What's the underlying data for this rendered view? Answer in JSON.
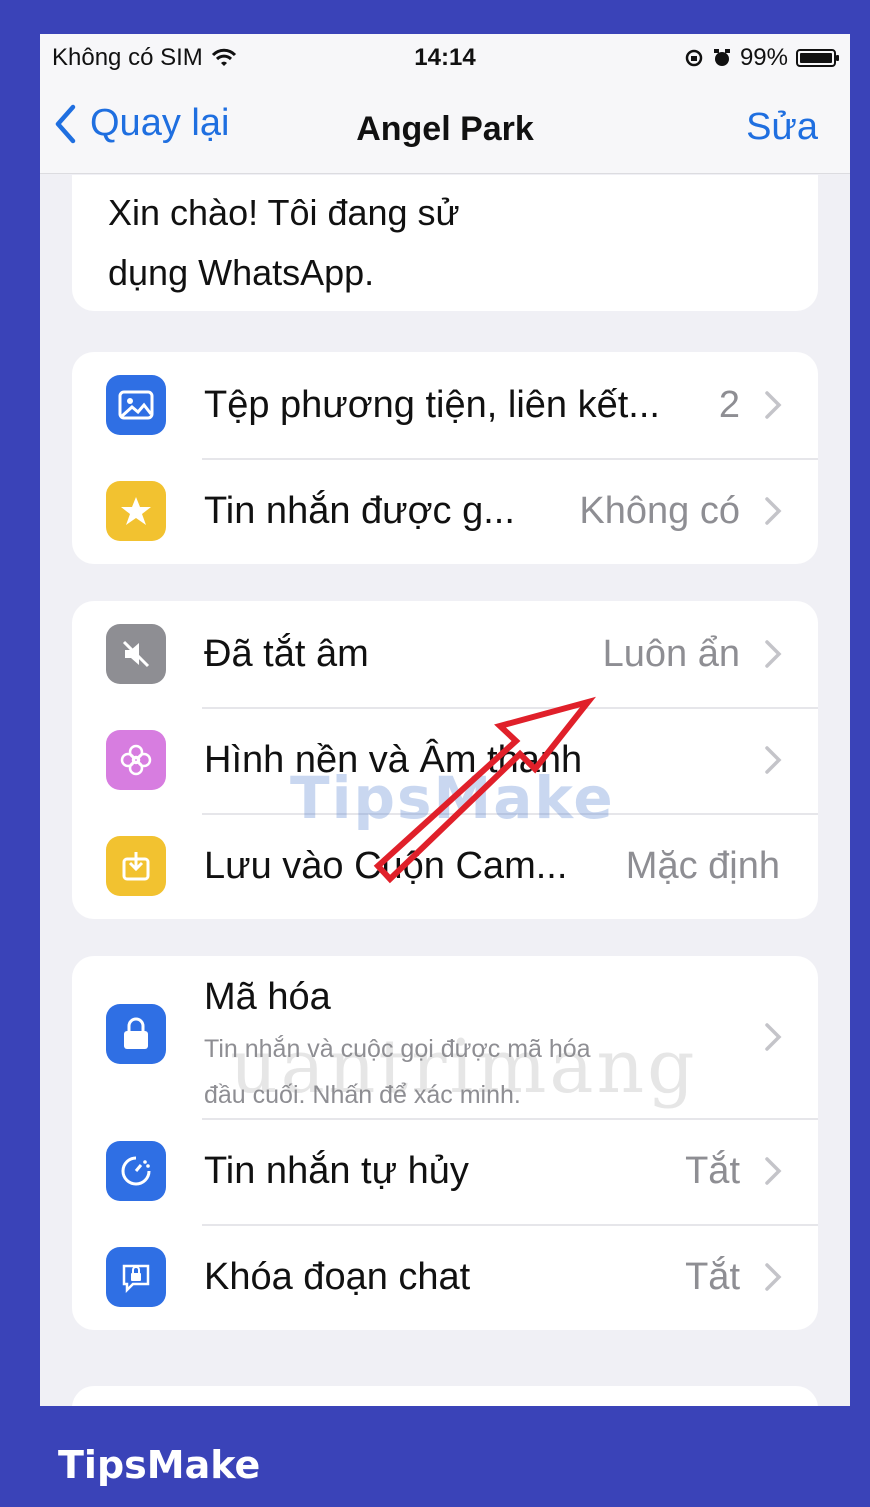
{
  "status": {
    "carrier": "Không có SIM",
    "time": "14:14",
    "battery": "99%",
    "battery_level": 0.99
  },
  "nav": {
    "back_label": "Quay lại",
    "title": "Angel Park",
    "edit_label": "Sửa"
  },
  "about": {
    "line1": "Xin chào! Tôi đang sử",
    "line2": "dụng WhatsApp."
  },
  "group1": [
    {
      "label": "Tệp phương tiện, liên kết...",
      "value": "2",
      "icon": "photo-icon",
      "color": "#2f6fe4"
    },
    {
      "label": "Tin nhắn được g...",
      "value": "Không có",
      "icon": "star-icon",
      "color": "#f2c230"
    }
  ],
  "group2": [
    {
      "label": "Đã tắt âm",
      "value": "Luôn ẩn",
      "icon": "mute-icon",
      "color": "#8e8e93"
    },
    {
      "label": "Hình nền và Âm thanh",
      "value": "",
      "icon": "flower-icon",
      "color": "#d77de0"
    },
    {
      "label": "Lưu vào Cuộn Cam...",
      "value": "Mặc định",
      "icon": "save-icon",
      "color": "#f2c230"
    }
  ],
  "group3": [
    {
      "label": "Mã hóa",
      "sub1": "Tin nhắn và cuộc gọi được mã hóa",
      "sub2": "đầu cuối. Nhấn để xác minh.",
      "value": "",
      "icon": "lock-icon",
      "color": "#2f6fe4"
    },
    {
      "label": "Tin nhắn tự hủy",
      "value": "Tắt",
      "icon": "timer-icon",
      "color": "#2f6fe4"
    },
    {
      "label": "Khóa đoạn chat",
      "value": "Tắt",
      "icon": "chat-lock-icon",
      "color": "#2f6fe4"
    }
  ],
  "watermarks": {
    "tipsmake": "TipsMake",
    "quantrimang": "uantrimang"
  },
  "brand": "TipsMake",
  "colors": {
    "accent": "#1f6fe0",
    "frame": "#3a43b8",
    "arrow": "#e0202a"
  }
}
